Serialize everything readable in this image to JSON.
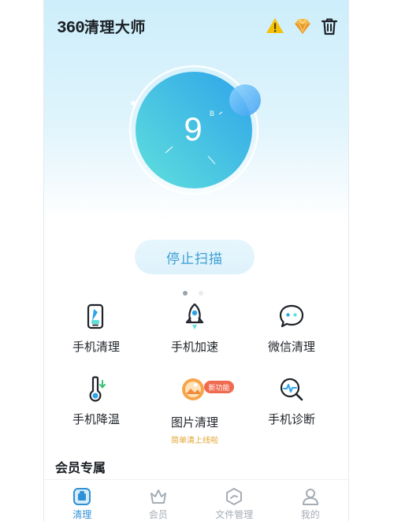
{
  "app": {
    "name_num": "360",
    "name_text": "清理大师"
  },
  "header": {
    "icons": [
      "warning-icon",
      "diamond-icon",
      "trash-icon"
    ]
  },
  "scan": {
    "value": "9",
    "unit": "B",
    "stop_label": "停止扫描"
  },
  "pager": {
    "pages": 2,
    "active": 0
  },
  "tools": [
    {
      "label": "手机清理",
      "icon": "phone-clean-icon"
    },
    {
      "label": "手机加速",
      "icon": "rocket-icon"
    },
    {
      "label": "微信清理",
      "icon": "wechat-icon"
    },
    {
      "label": "手机降温",
      "icon": "thermometer-icon"
    },
    {
      "label": "图片清理",
      "icon": "image-icon",
      "badge": "新功能",
      "sub": "简单清上线啦"
    },
    {
      "label": "手机诊断",
      "icon": "diagnosis-icon"
    }
  ],
  "section": {
    "title": "会员专属"
  },
  "tabbar": {
    "active": 0,
    "items": [
      {
        "label": "清理",
        "icon": "clean-tab-icon"
      },
      {
        "label": "会员",
        "icon": "crown-icon"
      },
      {
        "label": "文件管理",
        "icon": "folder-icon"
      },
      {
        "label": "我的",
        "icon": "user-icon"
      }
    ]
  },
  "colors": {
    "accent": "#2f90d6",
    "ring_start": "#5fe0dc",
    "ring_end": "#2ea3ea",
    "badge": "#f06a50",
    "sub_text": "#e3a532"
  }
}
